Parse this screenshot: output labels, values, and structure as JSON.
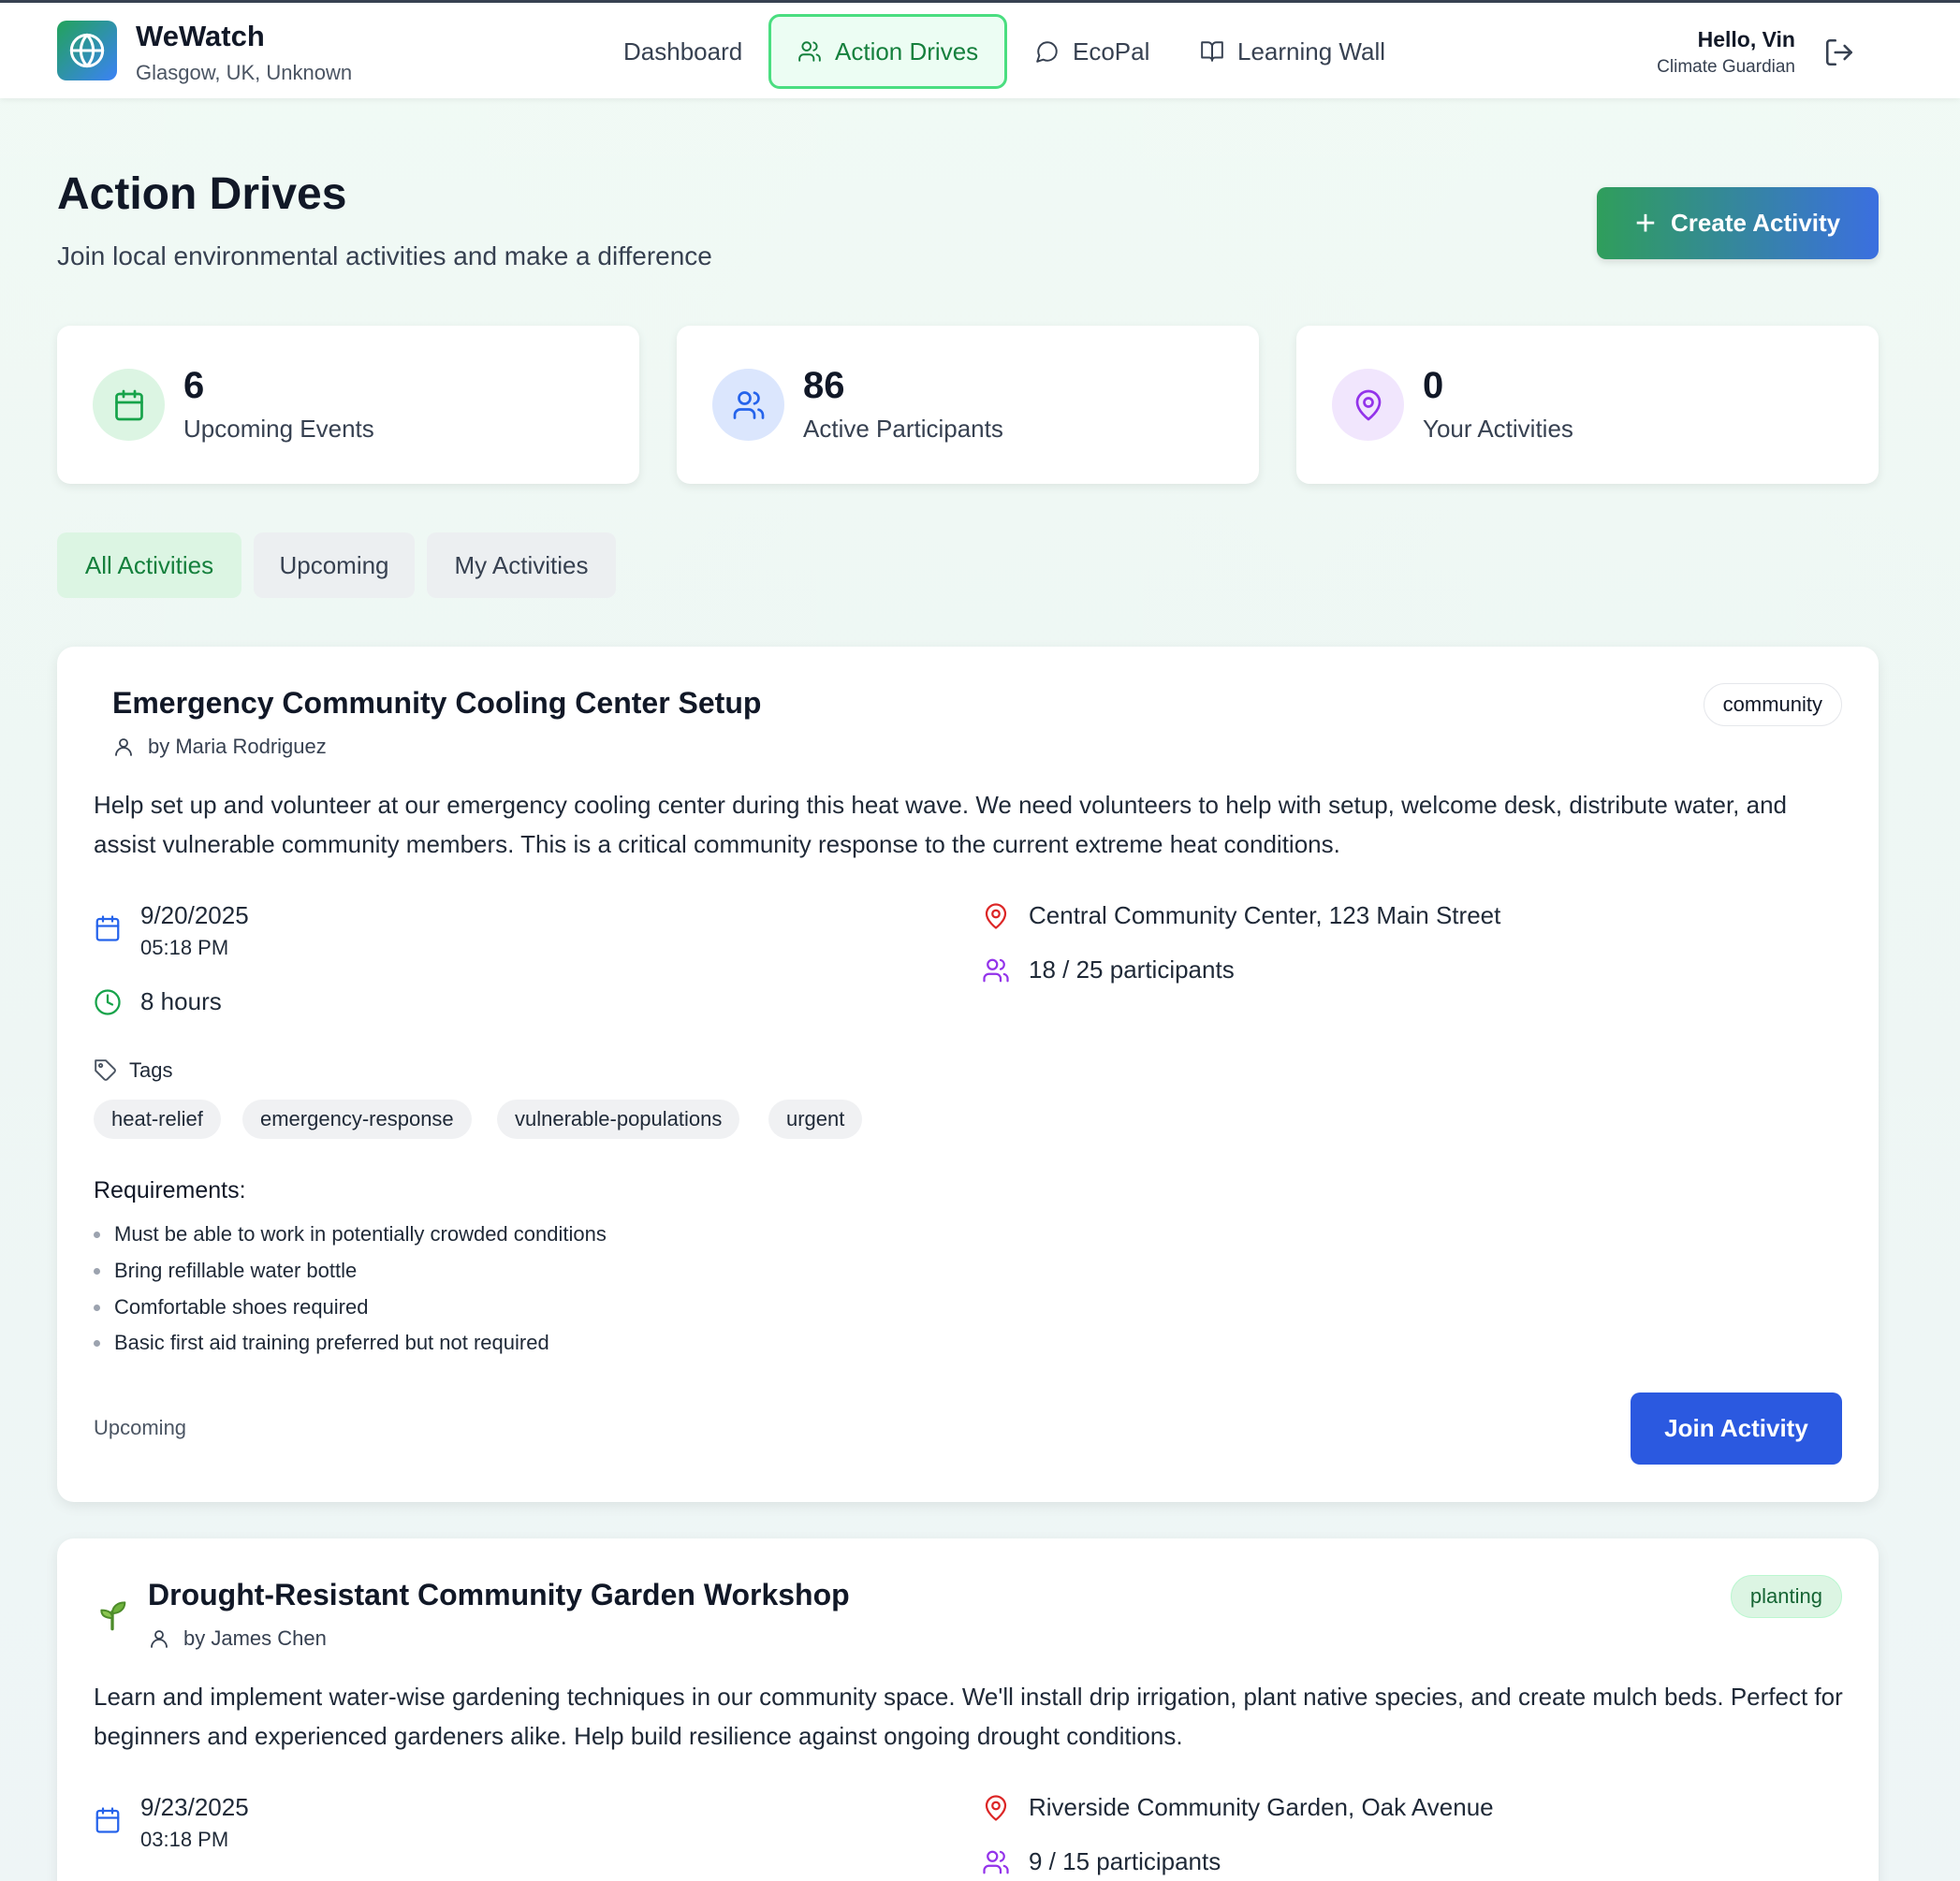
{
  "header": {
    "brand": "WeWatch",
    "location": "Glasgow, UK, Unknown",
    "nav": [
      {
        "label": "Dashboard",
        "icon": "none"
      },
      {
        "label": "Action Drives",
        "icon": "users-icon"
      },
      {
        "label": "EcoPal",
        "icon": "chat-bubble-icon"
      },
      {
        "label": "Learning Wall",
        "icon": "book-icon"
      }
    ],
    "greeting": "Hello, Vin",
    "role": "Climate Guardian"
  },
  "page": {
    "title": "Action Drives",
    "subtitle": "Join local environmental activities and make a difference",
    "create_label": "Create Activity"
  },
  "stats": [
    {
      "value": "6",
      "label": "Upcoming Events",
      "icon": "calendar-icon",
      "color": "#16a34a",
      "bg": "#dcf5e3"
    },
    {
      "value": "86",
      "label": "Active Participants",
      "icon": "users-icon",
      "color": "#2563eb",
      "bg": "#dbe6fd"
    },
    {
      "value": "0",
      "label": "Your Activities",
      "icon": "map-pin-icon",
      "color": "#9333ea",
      "bg": "#f1e6fd"
    }
  ],
  "tabs": [
    "All Activities",
    "Upcoming",
    "My Activities"
  ],
  "activities": [
    {
      "title": "Emergency Community Cooling Center Setup",
      "author": "by Maria Rodriguez",
      "category": "community",
      "description": "Help set up and volunteer at our emergency cooling center during this heat wave. We need volunteers to help with setup, welcome desk, distribute water, and assist vulnerable community members. This is a critical community response to the current extreme heat conditions.",
      "date": "9/20/2025",
      "time": "05:18 PM",
      "duration": "8 hours",
      "location": "Central Community Center, 123 Main Street",
      "participants": "18 / 25 participants",
      "tags_label": "Tags",
      "tags": [
        "heat-relief",
        "emergency-response",
        "vulnerable-populations",
        "urgent"
      ],
      "requirements_label": "Requirements:",
      "requirements": [
        "Must be able to work in potentially crowded conditions",
        "Bring refillable water bottle",
        "Comfortable shoes required",
        "Basic first aid training preferred but not required"
      ],
      "status": "Upcoming",
      "join_label": "Join Activity"
    },
    {
      "title": "Drought-Resistant Community Garden Workshop",
      "author": "by James Chen",
      "category": "planting",
      "description": "Learn and implement water-wise gardening techniques in our community space. We'll install drip irrigation, plant native species, and create mulch beds. Perfect for beginners and experienced gardeners alike. Help build resilience against ongoing drought conditions.",
      "date": "9/23/2025",
      "time": "03:18 PM",
      "location": "Riverside Community Garden, Oak Avenue",
      "participants": "9 / 15 participants"
    }
  ],
  "colors": {
    "accent_green": "#15803d",
    "join_blue": "#2b59e0",
    "location_red": "#dc2626",
    "participants_purple": "#9333ea"
  }
}
